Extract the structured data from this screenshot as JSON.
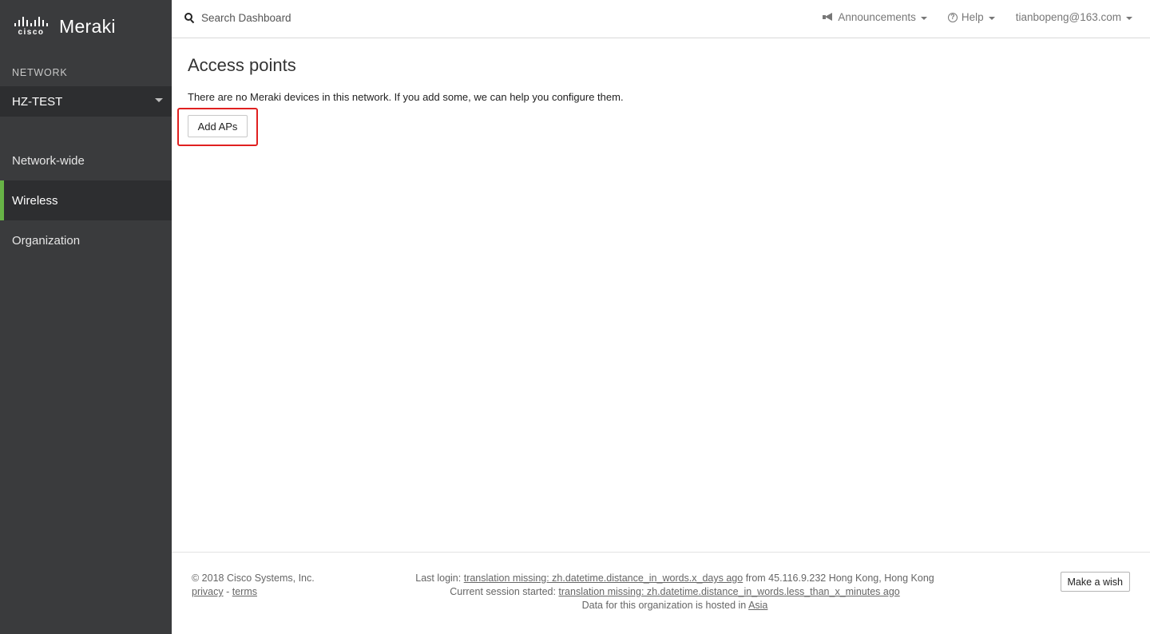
{
  "brand": {
    "cisco": "cisco",
    "product": "Meraki"
  },
  "sidebar": {
    "network_label": "NETWORK",
    "network_selected": "HZ-TEST",
    "items": [
      {
        "label": "Network-wide"
      },
      {
        "label": "Wireless",
        "active": true
      },
      {
        "label": "Organization"
      }
    ]
  },
  "topbar": {
    "search_placeholder": "Search Dashboard",
    "announcements": "Announcements",
    "help": "Help",
    "help_glyph": "?",
    "user": "tianbopeng@163.com"
  },
  "main": {
    "title": "Access points",
    "message": "There are no Meraki devices in this network. If you add some, we can help you configure them.",
    "add_button": "Add APs"
  },
  "footer": {
    "copyright": "© 2018 Cisco Systems, Inc.",
    "privacy": "privacy",
    "sep": "-",
    "terms": "terms",
    "last_login_prefix": "Last login: ",
    "last_login_link": "translation missing: zh.datetime.distance_in_words.x_days ago",
    "last_login_suffix": " from 45.116.9.232 Hong Kong, Hong Kong",
    "session_prefix": "Current session started: ",
    "session_link": "translation missing: zh.datetime.distance_in_words.less_than_x_minutes ago",
    "hosted_prefix": "Data for this organization is hosted in ",
    "hosted_link": "Asia",
    "wish_button": "Make a wish"
  },
  "colors": {
    "sidebar_bg": "#3a3b3d",
    "active_accent": "#67b346",
    "highlight": "#e02020"
  }
}
